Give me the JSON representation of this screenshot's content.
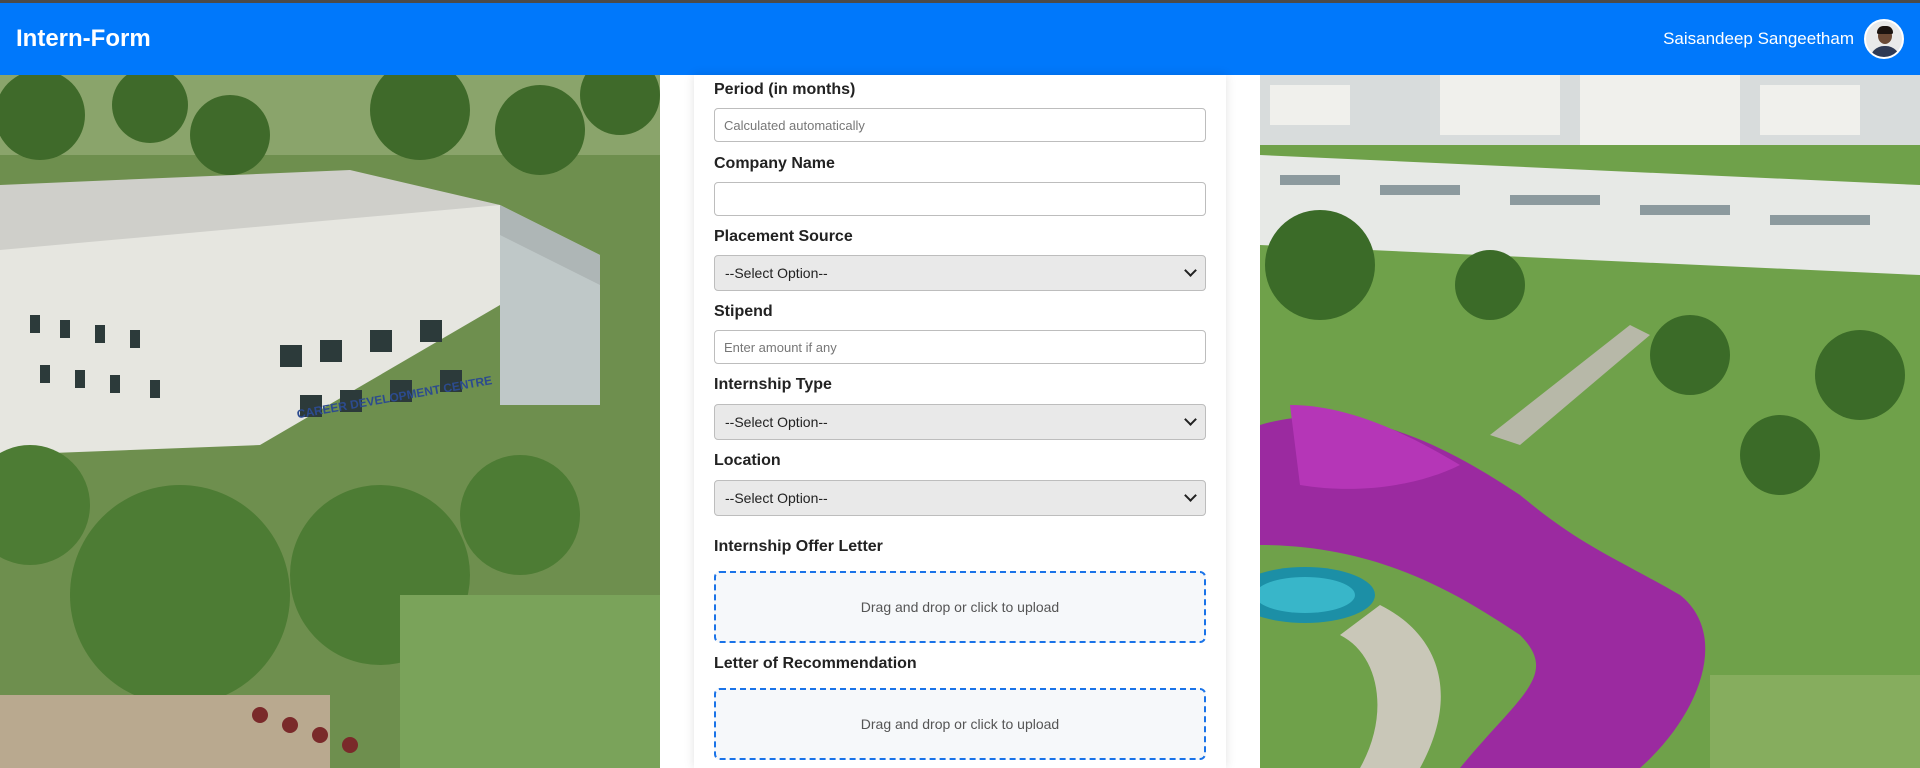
{
  "header": {
    "brand": "Intern-Form",
    "user_name": "Saisandeep Sangeetham"
  },
  "background": {
    "left_building_sign": "CAREER DEVELOPMENT CENTRE"
  },
  "form": {
    "period": {
      "label": "Period (in months)",
      "placeholder": "Calculated automatically",
      "value": ""
    },
    "company": {
      "label": "Company Name",
      "placeholder": "",
      "value": ""
    },
    "placement_source": {
      "label": "Placement Source",
      "selected": "--Select Option--"
    },
    "stipend": {
      "label": "Stipend",
      "placeholder": "Enter amount if any",
      "value": ""
    },
    "internship_type": {
      "label": "Internship Type",
      "selected": "--Select Option--"
    },
    "location": {
      "label": "Location",
      "selected": "--Select Option--"
    },
    "offer_letter": {
      "label": "Internship Offer Letter",
      "upload_text": "Drag and drop or click to upload"
    },
    "recommendation": {
      "label": "Letter of Recommendation",
      "upload_text": "Drag and drop or click to upload"
    }
  },
  "colors": {
    "header_bg": "#0078fb",
    "upload_border": "#1a73e8",
    "select_bg": "#e9e9e9"
  }
}
